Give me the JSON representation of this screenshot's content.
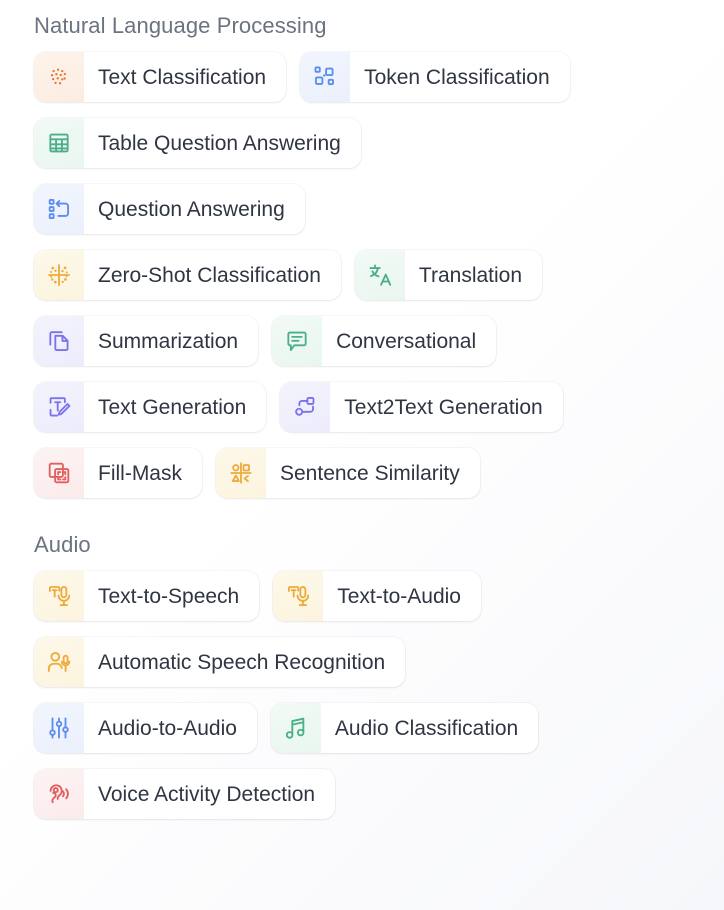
{
  "sections": [
    {
      "id": "nlp",
      "title": "Natural Language Processing",
      "rows": [
        [
          {
            "label": "Text Classification",
            "icon": "text-classification-icon",
            "color": "#e8732a",
            "tint": "tint-orange"
          },
          {
            "label": "Token Classification",
            "icon": "token-classification-icon",
            "color": "#5b8def",
            "tint": "tint-blue"
          }
        ],
        [
          {
            "label": "Table Question Answering",
            "icon": "table-question-answering-icon",
            "color": "#4caf87",
            "tint": "tint-green"
          }
        ],
        [
          {
            "label": "Question Answering",
            "icon": "question-answering-icon",
            "color": "#5b8def",
            "tint": "tint-blue"
          }
        ],
        [
          {
            "label": "Zero-Shot Classification",
            "icon": "zero-shot-classification-icon",
            "color": "#eeab3c",
            "tint": "tint-yellow"
          },
          {
            "label": "Translation",
            "icon": "translation-icon",
            "color": "#4caf87",
            "tint": "tint-green"
          }
        ],
        [
          {
            "label": "Summarization",
            "icon": "summarization-icon",
            "color": "#7a72ef",
            "tint": "tint-indigo"
          },
          {
            "label": "Conversational",
            "icon": "conversational-icon",
            "color": "#4caf87",
            "tint": "tint-green"
          }
        ],
        [
          {
            "label": "Text Generation",
            "icon": "text-generation-icon",
            "color": "#7a72ef",
            "tint": "tint-indigo"
          },
          {
            "label": "Text2Text Generation",
            "icon": "text2text-generation-icon",
            "color": "#7a72ef",
            "tint": "tint-indigo"
          }
        ],
        [
          {
            "label": "Fill-Mask",
            "icon": "fill-mask-icon",
            "color": "#e35f5f",
            "tint": "tint-red"
          },
          {
            "label": "Sentence Similarity",
            "icon": "sentence-similarity-icon",
            "color": "#eeab3c",
            "tint": "tint-yellow"
          }
        ]
      ]
    },
    {
      "id": "audio",
      "title": "Audio",
      "rows": [
        [
          {
            "label": "Text-to-Speech",
            "icon": "text-to-speech-icon",
            "color": "#eeab3c",
            "tint": "tint-yellow"
          },
          {
            "label": "Text-to-Audio",
            "icon": "text-to-audio-icon",
            "color": "#eeab3c",
            "tint": "tint-yellow"
          }
        ],
        [
          {
            "label": "Automatic Speech Recognition",
            "icon": "automatic-speech-recognition-icon",
            "color": "#eeab3c",
            "tint": "tint-yellow"
          }
        ],
        [
          {
            "label": "Audio-to-Audio",
            "icon": "audio-to-audio-icon",
            "color": "#5b8def",
            "tint": "tint-blue"
          },
          {
            "label": "Audio Classification",
            "icon": "audio-classification-icon",
            "color": "#4caf87",
            "tint": "tint-green"
          }
        ],
        [
          {
            "label": "Voice Activity Detection",
            "icon": "voice-activity-detection-icon",
            "color": "#e35f5f",
            "tint": "tint-red"
          }
        ]
      ]
    }
  ]
}
